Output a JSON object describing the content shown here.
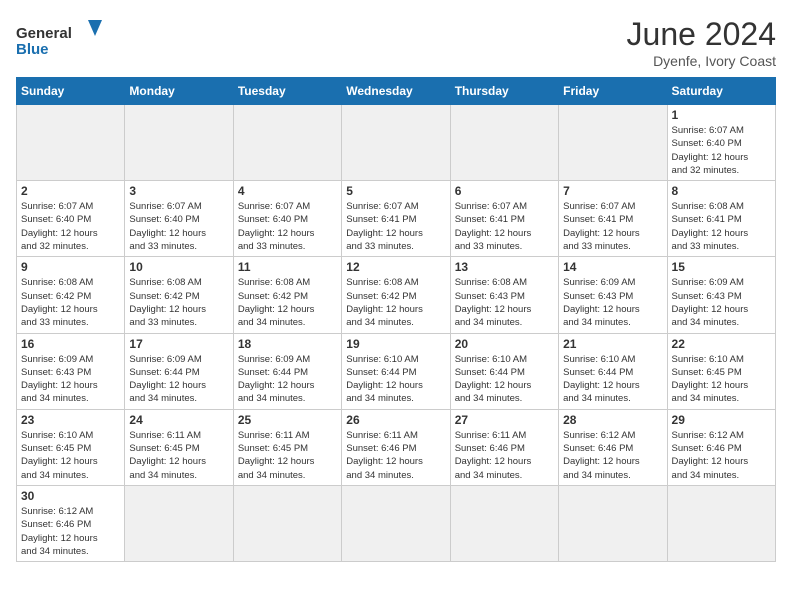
{
  "header": {
    "logo_general": "General",
    "logo_blue": "Blue",
    "title": "June 2024",
    "subtitle": "Dyenfe, Ivory Coast"
  },
  "weekdays": [
    "Sunday",
    "Monday",
    "Tuesday",
    "Wednesday",
    "Thursday",
    "Friday",
    "Saturday"
  ],
  "days": {
    "d1": {
      "num": "1",
      "info": "Sunrise: 6:07 AM\nSunset: 6:40 PM\nDaylight: 12 hours\nand 32 minutes."
    },
    "d2": {
      "num": "2",
      "info": "Sunrise: 6:07 AM\nSunset: 6:40 PM\nDaylight: 12 hours\nand 32 minutes."
    },
    "d3": {
      "num": "3",
      "info": "Sunrise: 6:07 AM\nSunset: 6:40 PM\nDaylight: 12 hours\nand 33 minutes."
    },
    "d4": {
      "num": "4",
      "info": "Sunrise: 6:07 AM\nSunset: 6:40 PM\nDaylight: 12 hours\nand 33 minutes."
    },
    "d5": {
      "num": "5",
      "info": "Sunrise: 6:07 AM\nSunset: 6:41 PM\nDaylight: 12 hours\nand 33 minutes."
    },
    "d6": {
      "num": "6",
      "info": "Sunrise: 6:07 AM\nSunset: 6:41 PM\nDaylight: 12 hours\nand 33 minutes."
    },
    "d7": {
      "num": "7",
      "info": "Sunrise: 6:07 AM\nSunset: 6:41 PM\nDaylight: 12 hours\nand 33 minutes."
    },
    "d8": {
      "num": "8",
      "info": "Sunrise: 6:08 AM\nSunset: 6:41 PM\nDaylight: 12 hours\nand 33 minutes."
    },
    "d9": {
      "num": "9",
      "info": "Sunrise: 6:08 AM\nSunset: 6:42 PM\nDaylight: 12 hours\nand 33 minutes."
    },
    "d10": {
      "num": "10",
      "info": "Sunrise: 6:08 AM\nSunset: 6:42 PM\nDaylight: 12 hours\nand 33 minutes."
    },
    "d11": {
      "num": "11",
      "info": "Sunrise: 6:08 AM\nSunset: 6:42 PM\nDaylight: 12 hours\nand 34 minutes."
    },
    "d12": {
      "num": "12",
      "info": "Sunrise: 6:08 AM\nSunset: 6:42 PM\nDaylight: 12 hours\nand 34 minutes."
    },
    "d13": {
      "num": "13",
      "info": "Sunrise: 6:08 AM\nSunset: 6:43 PM\nDaylight: 12 hours\nand 34 minutes."
    },
    "d14": {
      "num": "14",
      "info": "Sunrise: 6:09 AM\nSunset: 6:43 PM\nDaylight: 12 hours\nand 34 minutes."
    },
    "d15": {
      "num": "15",
      "info": "Sunrise: 6:09 AM\nSunset: 6:43 PM\nDaylight: 12 hours\nand 34 minutes."
    },
    "d16": {
      "num": "16",
      "info": "Sunrise: 6:09 AM\nSunset: 6:43 PM\nDaylight: 12 hours\nand 34 minutes."
    },
    "d17": {
      "num": "17",
      "info": "Sunrise: 6:09 AM\nSunset: 6:44 PM\nDaylight: 12 hours\nand 34 minutes."
    },
    "d18": {
      "num": "18",
      "info": "Sunrise: 6:09 AM\nSunset: 6:44 PM\nDaylight: 12 hours\nand 34 minutes."
    },
    "d19": {
      "num": "19",
      "info": "Sunrise: 6:10 AM\nSunset: 6:44 PM\nDaylight: 12 hours\nand 34 minutes."
    },
    "d20": {
      "num": "20",
      "info": "Sunrise: 6:10 AM\nSunset: 6:44 PM\nDaylight: 12 hours\nand 34 minutes."
    },
    "d21": {
      "num": "21",
      "info": "Sunrise: 6:10 AM\nSunset: 6:44 PM\nDaylight: 12 hours\nand 34 minutes."
    },
    "d22": {
      "num": "22",
      "info": "Sunrise: 6:10 AM\nSunset: 6:45 PM\nDaylight: 12 hours\nand 34 minutes."
    },
    "d23": {
      "num": "23",
      "info": "Sunrise: 6:10 AM\nSunset: 6:45 PM\nDaylight: 12 hours\nand 34 minutes."
    },
    "d24": {
      "num": "24",
      "info": "Sunrise: 6:11 AM\nSunset: 6:45 PM\nDaylight: 12 hours\nand 34 minutes."
    },
    "d25": {
      "num": "25",
      "info": "Sunrise: 6:11 AM\nSunset: 6:45 PM\nDaylight: 12 hours\nand 34 minutes."
    },
    "d26": {
      "num": "26",
      "info": "Sunrise: 6:11 AM\nSunset: 6:46 PM\nDaylight: 12 hours\nand 34 minutes."
    },
    "d27": {
      "num": "27",
      "info": "Sunrise: 6:11 AM\nSunset: 6:46 PM\nDaylight: 12 hours\nand 34 minutes."
    },
    "d28": {
      "num": "28",
      "info": "Sunrise: 6:12 AM\nSunset: 6:46 PM\nDaylight: 12 hours\nand 34 minutes."
    },
    "d29": {
      "num": "29",
      "info": "Sunrise: 6:12 AM\nSunset: 6:46 PM\nDaylight: 12 hours\nand 34 minutes."
    },
    "d30": {
      "num": "30",
      "info": "Sunrise: 6:12 AM\nSunset: 6:46 PM\nDaylight: 12 hours\nand 34 minutes."
    }
  }
}
